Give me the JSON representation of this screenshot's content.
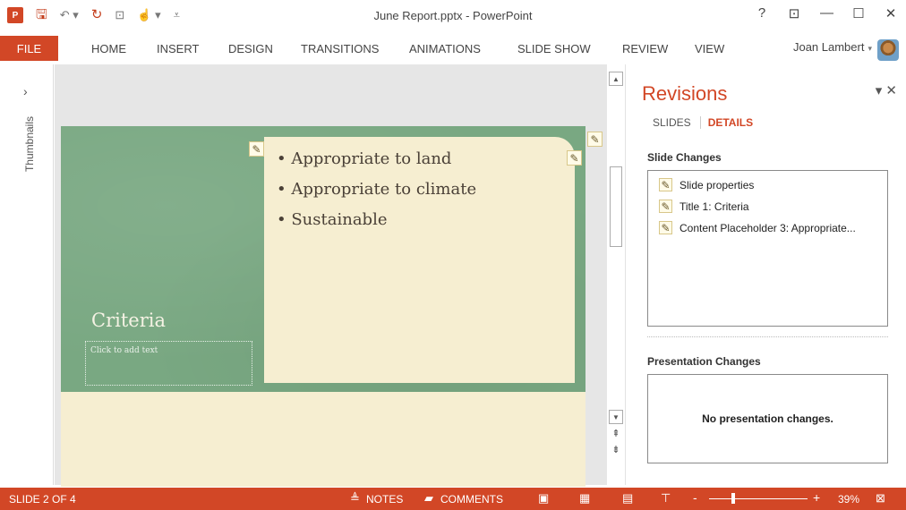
{
  "titlebar": {
    "app_icon": "P",
    "doc_title": "June Report.pptx - PowerPoint",
    "icons": [
      "save-icon",
      "undo-icon",
      "redo-icon",
      "from-beginning-icon",
      "touch-mode-icon",
      "customize-qat-icon"
    ],
    "window_controls": {
      "help": "?",
      "ribbon_display": "⊡",
      "minimize": "—",
      "maximize": "☐",
      "close": "✕"
    }
  },
  "ribbon": {
    "file": "FILE",
    "tabs": [
      "HOME",
      "INSERT",
      "DESIGN",
      "TRANSITIONS",
      "ANIMATIONS",
      "SLIDE SHOW",
      "REVIEW",
      "VIEW"
    ],
    "user": "Joan Lambert"
  },
  "thumbnails": {
    "label": "Thumbnails",
    "chevron": "›"
  },
  "slide": {
    "bullets": [
      "• Appropriate to land",
      "• Appropriate to climate",
      "• Sustainable"
    ],
    "title": "Criteria",
    "subtitle_placeholder": "Click to add text"
  },
  "revisions": {
    "title": "Revisions",
    "tabs": [
      "SLIDES",
      "DETAILS"
    ],
    "active_tab": "DETAILS",
    "slide_changes_heading": "Slide Changes",
    "slide_changes": [
      "Slide properties",
      "Title 1: Criteria",
      "Content Placeholder 3: Appropriate..."
    ],
    "presentation_changes_heading": "Presentation Changes",
    "no_presentation_changes": "No presentation changes."
  },
  "statusbar": {
    "slide_indicator": "SLIDE 2 OF 4",
    "notes": "NOTES",
    "comments": "COMMENTS",
    "zoom_percent": "39%",
    "zoom_minus": "-",
    "zoom_plus": "+",
    "zoom_fraction": 0.39
  },
  "colors": {
    "accent": "#d24726",
    "slide_green": "#79a882",
    "slide_cream": "#f6eed1"
  }
}
